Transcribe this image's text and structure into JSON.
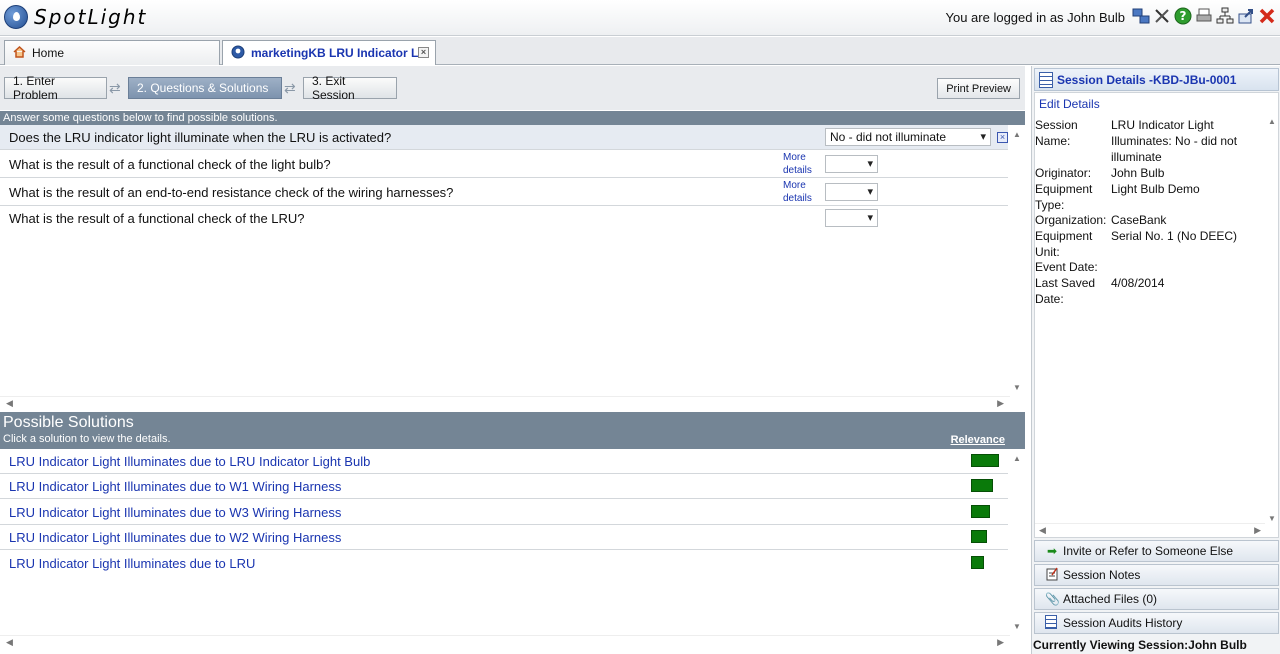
{
  "header": {
    "logo_text": "SpotLight",
    "logged_in_text": "You are logged in as John Bulb"
  },
  "tabs": [
    {
      "label": "Home"
    },
    {
      "label": "marketingKB LRU Indicator Li"
    }
  ],
  "steps": [
    {
      "label": "1. Enter Problem"
    },
    {
      "label": "2. Questions & Solutions"
    },
    {
      "label": "3. Exit Session"
    }
  ],
  "print_preview": "Print Preview",
  "questions_hint": "Answer some questions below to find possible solutions.",
  "questions": [
    {
      "text": "Does the LRU indicator light illuminate when the LRU is activated?",
      "answer": "No - did not illuminate",
      "more": ""
    },
    {
      "text": "What is the result of a functional check of the light bulb?",
      "answer": "",
      "more": "More details"
    },
    {
      "text": "What is the result of an end-to-end resistance check of the wiring harnesses?",
      "answer": "",
      "more": "More details"
    },
    {
      "text": "What is the result of a functional check of the LRU?",
      "answer": "",
      "more": ""
    }
  ],
  "solutions_panel": {
    "title": "Possible Solutions",
    "subtitle": "Click a solution to view the details.",
    "relevance_label": "Relevance"
  },
  "solutions": [
    {
      "label": "LRU Indicator Light Illuminates due to LRU Indicator Light Bulb",
      "relevance": 1.0
    },
    {
      "label": "LRU Indicator Light Illuminates due to W1 Wiring Harness",
      "relevance": 0.79
    },
    {
      "label": "LRU Indicator Light Illuminates due to W3 Wiring Harness",
      "relevance": 0.68
    },
    {
      "label": "LRU Indicator Light Illuminates due to W2 Wiring Harness",
      "relevance": 0.57
    },
    {
      "label": "LRU Indicator Light Illuminates due to LRU",
      "relevance": 0.46
    }
  ],
  "session_panel": {
    "title": "Session Details -KBD-JBu-0001",
    "edit_details": "Edit Details",
    "fields": [
      {
        "key": "Session Name:",
        "value": "LRU Indicator Light Illuminates: No - did not illuminate"
      },
      {
        "key": "Originator:",
        "value": "John Bulb"
      },
      {
        "key": "Equipment Type:",
        "value": "Light Bulb Demo"
      },
      {
        "key": "Organization:",
        "value": "CaseBank"
      },
      {
        "key": "Equipment Unit:",
        "value": "Serial No. 1 (No DEEC)"
      },
      {
        "key": "Event Date:",
        "value": ""
      },
      {
        "key": "Last Saved Date:",
        "value": "4/08/2014"
      }
    ],
    "accordion": [
      {
        "label": "Invite or Refer to Someone Else",
        "icon": "arrow-right-icon"
      },
      {
        "label": "Session Notes",
        "icon": "notes-icon"
      },
      {
        "label": "Attached Files (0)",
        "icon": "paperclip-icon"
      },
      {
        "label": "Session Audits History",
        "icon": "document-icon"
      }
    ],
    "footer": "Currently Viewing Session:John Bulb"
  },
  "colors": {
    "accent_blue": "#1a35b0",
    "section_bar": "#748595",
    "relevance_green": "#0a7a0a"
  }
}
